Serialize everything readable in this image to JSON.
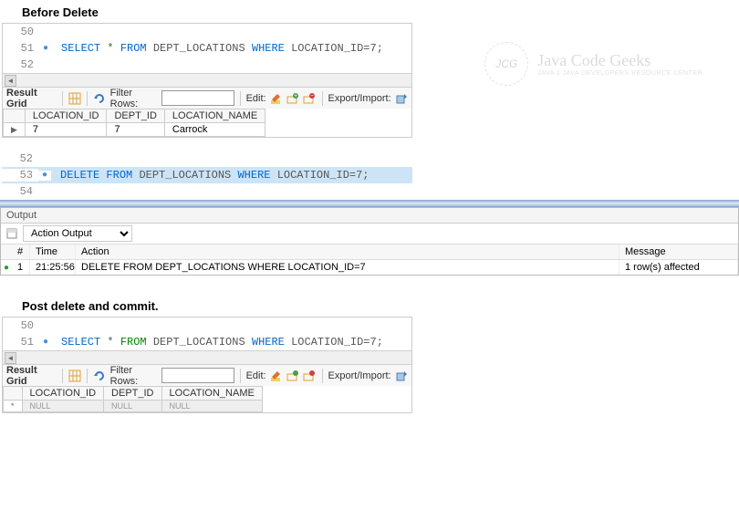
{
  "section1": {
    "title": "Before Delete"
  },
  "section2": {
    "title": "Post delete and commit."
  },
  "editor1": {
    "line_top_num": "50",
    "line_num": "51",
    "line_bul": "●",
    "code_select": "SELECT",
    "code_star": "*",
    "code_from": "FROM",
    "code_table": "DEPT_LOCATIONS",
    "code_where": "WHERE",
    "code_cond": "LOCATION_ID=7;",
    "line_next_num": "52"
  },
  "toolbar": {
    "result_grid": "Result Grid",
    "filter_rows": "Filter Rows:",
    "edit": "Edit:",
    "export_import": "Export/Import:"
  },
  "table1": {
    "headers": [
      "LOCATION_ID",
      "DEPT_ID",
      "LOCATION_NAME"
    ],
    "row1": [
      "7",
      "7",
      "Carrock"
    ]
  },
  "table2": {
    "headers": [
      "LOCATION_ID",
      "DEPT_ID",
      "LOCATION_NAME"
    ],
    "null_label": "NULL"
  },
  "editor2": {
    "line_top_num": "52",
    "line_num": "53",
    "line_bul": "●",
    "code_delete": "DELETE",
    "code_from": "FROM",
    "code_table": "DEPT_LOCATIONS",
    "code_where": "WHERE",
    "code_cond": "LOCATION_ID=7;",
    "line_next_num": "54"
  },
  "output": {
    "title": "Output",
    "dropdown": "Action Output",
    "col_num": "#",
    "col_time": "Time",
    "col_action": "Action",
    "col_message": "Message",
    "row1": {
      "num": "1",
      "time": "21:25:56",
      "action": "DELETE FROM DEPT_LOCATIONS WHERE LOCATION_ID=7",
      "message": "1 row(s) affected"
    }
  },
  "editor3": {
    "line_top_num": "50",
    "line_num": "51",
    "line_bul": "●",
    "code_select": "SELECT",
    "code_star": "*",
    "code_from": "FROM",
    "code_table": "DEPT_LOCATIONS",
    "code_where": "WHERE",
    "code_cond": "LOCATION_ID=7;"
  },
  "watermark": {
    "logo": "JCG",
    "text": "Java Code Geeks",
    "sub": "JAVA 2 JAVA DEVELOPERS RESOURCE CENTER"
  }
}
